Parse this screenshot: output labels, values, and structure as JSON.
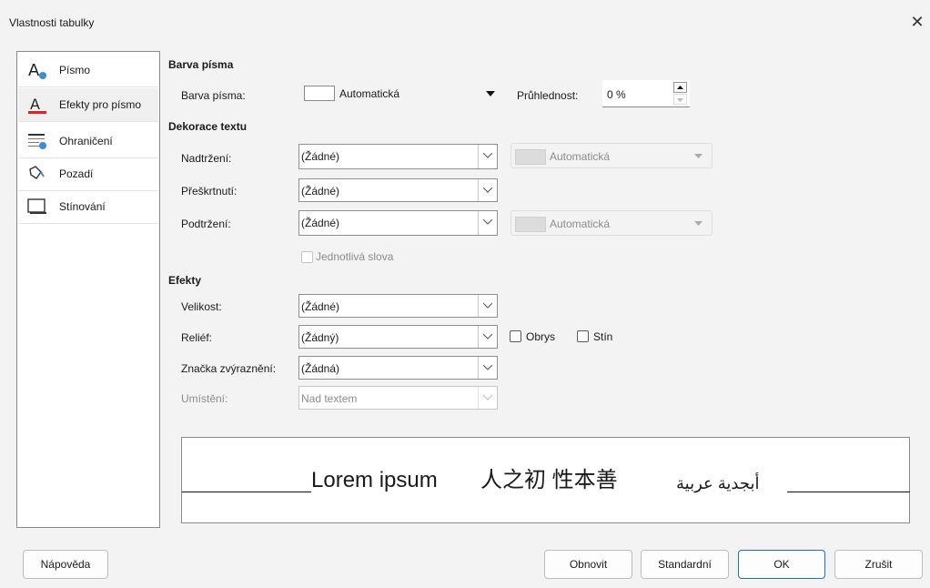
{
  "window": {
    "title": "Vlastnosti tabulky",
    "close_glyph": "✕"
  },
  "sidebar": {
    "items": [
      {
        "label": "Písmo",
        "icon": "font-icon"
      },
      {
        "label": "Efekty pro písmo",
        "icon": "font-effects-icon"
      },
      {
        "label": "Ohraničení",
        "icon": "borders-icon"
      },
      {
        "label": "Pozadí",
        "icon": "background-icon"
      },
      {
        "label": "Stínování",
        "icon": "shadow-icon"
      }
    ]
  },
  "font_color": {
    "heading": "Barva písma",
    "label": "Barva písma:",
    "value": "Automatická",
    "transparency_label": "Průhlednost:",
    "transparency_value": "0 %"
  },
  "decoration": {
    "heading": "Dekorace textu",
    "overline_label": "Nadtržení:",
    "overline_value": "(Žádné)",
    "overline_color": "Automatická",
    "strike_label": "Přeškrtnutí:",
    "strike_value": "(Žádné)",
    "underline_label": "Podtržení:",
    "underline_value": "(Žádné)",
    "underline_color": "Automatická",
    "individual_words": "Jednotlivá slova"
  },
  "effects": {
    "heading": "Efekty",
    "case_label": "Velikost:",
    "case_value": "(Žádné)",
    "relief_label": "Reliéf:",
    "relief_value": "(Žádný)",
    "outline_label": "Obrys",
    "shadow_label": "Stín",
    "emphasis_label": "Značka zvýraznění:",
    "emphasis_value": "(Žádná)",
    "position_label": "Umístění:",
    "position_value": "Nad textem"
  },
  "preview": {
    "latin": "Lorem ipsum",
    "cjk": "人之初 性本善",
    "ctl": "أبجدية عربية"
  },
  "buttons": {
    "help": "Nápověda",
    "reset": "Obnovit",
    "standard": "Standardní",
    "ok": "OK",
    "cancel": "Zrušit"
  }
}
